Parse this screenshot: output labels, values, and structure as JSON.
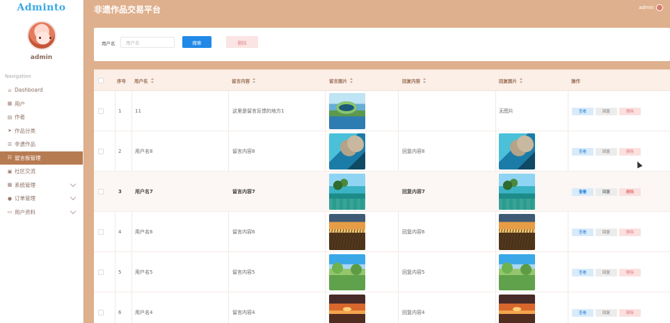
{
  "brand": "Adminto",
  "sidebar": {
    "username": "admin",
    "nav_title": "Navigation",
    "items": [
      {
        "label": "Dashboard",
        "icon": "home-icon"
      },
      {
        "label": "用户",
        "icon": "grid-icon"
      },
      {
        "label": "作者",
        "icon": "clipboard-icon"
      },
      {
        "label": "作品分类",
        "icon": "send-icon"
      },
      {
        "label": "非遗作品",
        "icon": "sliders-icon"
      },
      {
        "label": "留言板管理",
        "icon": "list-icon"
      },
      {
        "label": "社区交流",
        "icon": "briefcase-icon"
      },
      {
        "label": "系统管理",
        "icon": "grid-icon"
      },
      {
        "label": "订单管理",
        "icon": "user-icon"
      },
      {
        "label": "用户资料",
        "icon": "card-icon"
      }
    ]
  },
  "header": {
    "title": "非遗作品交易平台",
    "user": "admin"
  },
  "search": {
    "label": "用户名",
    "placeholder": "用户名",
    "search_button": "搜索",
    "delete_button": "删除"
  },
  "table": {
    "headers": {
      "index": "序号",
      "username": "用户名",
      "message": "留言内容",
      "message_image": "留言图片",
      "reply": "回复内容",
      "reply_image": "回复图片",
      "actions": "操作"
    },
    "rows": [
      {
        "index": "1",
        "username": "11",
        "message": "这里是留言反馈的地方1",
        "message_image": "img-lake",
        "reply": "",
        "reply_image": "",
        "reply_image_text": "无图片"
      },
      {
        "index": "2",
        "username": "用户名8",
        "message": "留言内容8",
        "message_image": "img-cliff",
        "reply": "回复内容8",
        "reply_image": "img-cliff",
        "reply_image_text": ""
      },
      {
        "index": "3",
        "username": "用户名7",
        "message": "留言内容7",
        "message_image": "img-tropical",
        "reply": "回复内容7",
        "reply_image": "img-tropical",
        "reply_image_text": ""
      },
      {
        "index": "4",
        "username": "用户名6",
        "message": "留言内容6",
        "message_image": "img-sunset",
        "reply": "回复内容6",
        "reply_image": "img-sunset",
        "reply_image_text": ""
      },
      {
        "index": "5",
        "username": "用户名5",
        "message": "留言内容5",
        "message_image": "img-meadow",
        "reply": "回复内容5",
        "reply_image": "img-meadow",
        "reply_image_text": ""
      },
      {
        "index": "6",
        "username": "用户名4",
        "message": "留言内容4",
        "message_image": "img-dusk",
        "reply": "回复内容4",
        "reply_image": "img-dusk",
        "reply_image_text": ""
      }
    ],
    "actions": {
      "view": "查看",
      "reply": "回复",
      "delete": "删除"
    }
  }
}
